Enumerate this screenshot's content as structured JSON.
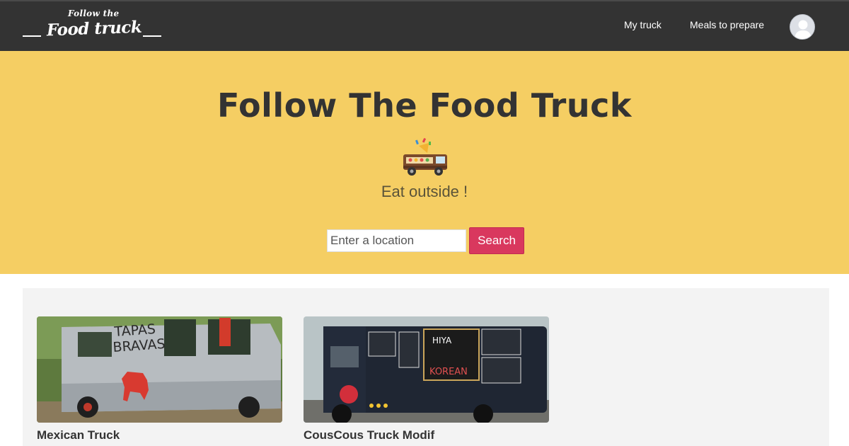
{
  "navbar": {
    "logo_small": "Follow the",
    "logo_big": "Food truck",
    "links": [
      "My truck",
      "Meals to prepare"
    ],
    "avatar_icon": "user-avatar-icon"
  },
  "hero": {
    "title": "Follow The Food Truck",
    "icon": "food-truck-icon",
    "subtitle": "Eat outside !",
    "search_placeholder": "Enter a location",
    "search_label": "Search",
    "background": "#f5ce63",
    "button_color": "#d9385e"
  },
  "trucks": [
    {
      "name": "Mexican Truck",
      "sign_line1": "TAPAS",
      "sign_line2": "BRAVAS"
    },
    {
      "name": "CousCous Truck Modif",
      "sign_line1": "HIYA",
      "sign_line2": "KOREAN"
    }
  ]
}
